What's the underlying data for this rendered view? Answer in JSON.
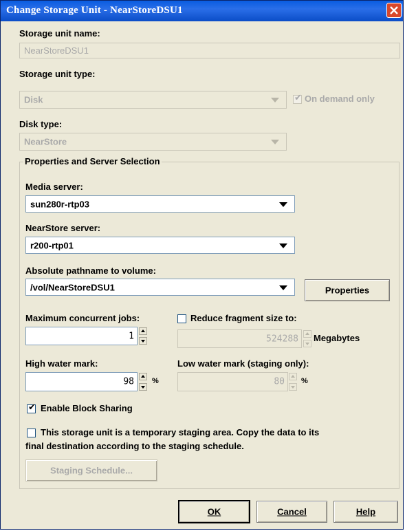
{
  "window": {
    "title": "Change Storage Unit - NearStoreDSU1"
  },
  "storage_unit_name": {
    "label": "Storage unit name:",
    "value": "NearStoreDSU1"
  },
  "storage_unit_type": {
    "label": "Storage unit type:",
    "value": "Disk",
    "on_demand_label": "On demand only",
    "on_demand_checked": true
  },
  "disk_type": {
    "label": "Disk type:",
    "value": "NearStore"
  },
  "properties_group": {
    "title": "Properties and Server Selection",
    "media_server": {
      "label": "Media server:",
      "value": "sun280r-rtp03"
    },
    "nearstore_server": {
      "label": "NearStore server:",
      "value": "r200-rtp01"
    },
    "pathname": {
      "label": "Absolute pathname to volume:",
      "value": "/vol/NearStoreDSU1",
      "properties_button": "Properties"
    },
    "max_jobs": {
      "label": "Maximum concurrent jobs:",
      "value": "1"
    },
    "reduce_fragment": {
      "label": "Reduce fragment size to:",
      "value": "524288",
      "unit": "Megabytes"
    },
    "high_water": {
      "label": "High water mark:",
      "value": "98",
      "unit": "%"
    },
    "low_water": {
      "label": "Low water mark (staging only):",
      "value": "80",
      "unit": "%"
    },
    "block_sharing": {
      "label": "Enable Block Sharing",
      "checked": true
    },
    "staging": {
      "line1": "This storage unit is a temporary staging area.  Copy the data to its",
      "line2": "final destination according to the staging schedule."
    },
    "staging_schedule_button": "Staging Schedule..."
  },
  "buttons": {
    "ok": "OK",
    "cancel": "Cancel",
    "help": "Help"
  }
}
